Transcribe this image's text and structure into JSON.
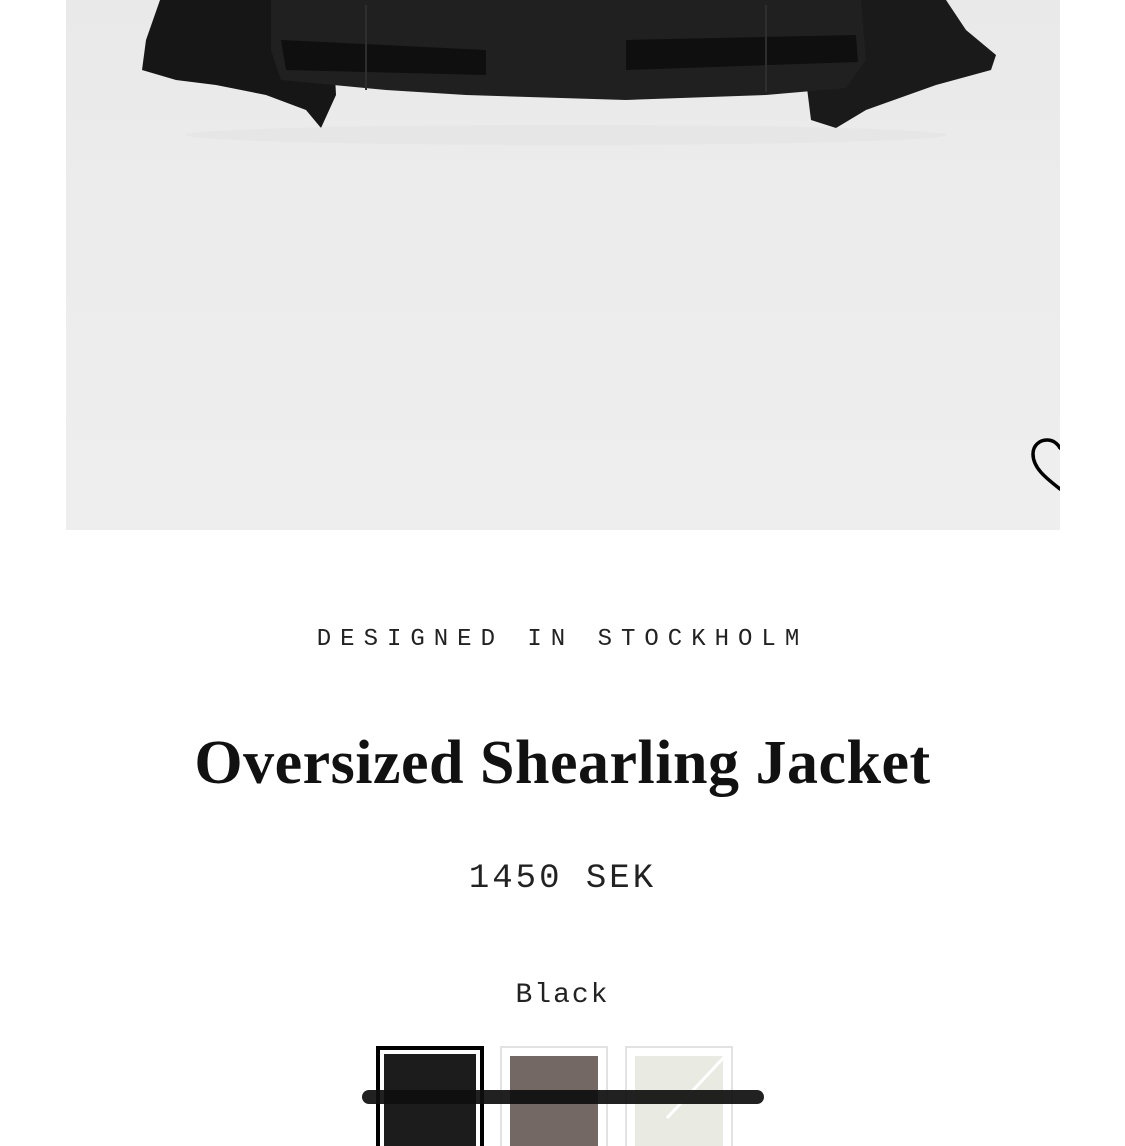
{
  "product": {
    "tagline": "DESIGNED IN STOCKHOLM",
    "title": "Oversized Shearling Jacket",
    "price": "1450 SEK",
    "selected_color": "Black"
  },
  "icons": {
    "favorite": "heart-icon"
  },
  "swatches": [
    {
      "name": "black",
      "color": "#1c1c1c",
      "selected": true
    },
    {
      "name": "brown",
      "color": "#736863",
      "selected": false
    },
    {
      "name": "cream",
      "color": "#e9ebe3",
      "selected": false
    }
  ],
  "colors": {
    "background": "#ffffff",
    "image_background": "#ececec",
    "text": "#111111"
  }
}
